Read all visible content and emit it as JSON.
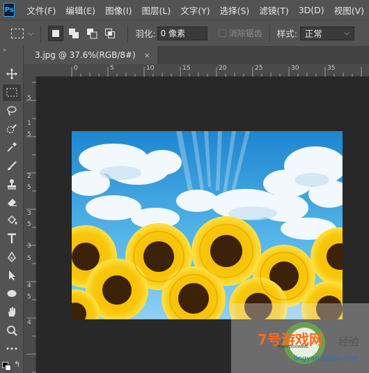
{
  "app": {
    "logo": "Ps"
  },
  "menu": [
    "文件(F)",
    "编辑(E)",
    "图像(I)",
    "图层(L)",
    "文字(Y)",
    "选择(S)",
    "滤镜(T)",
    "3D(D)",
    "视图(V)"
  ],
  "options": {
    "feather_label": "羽化:",
    "feather_value": "0 像素",
    "antialias_label": "消除锯齿",
    "style_label": "样式:",
    "style_value": "正常"
  },
  "document": {
    "tab_title": "3.jpg @ 37.6%(RGB/8#)",
    "close_glyph": "×"
  },
  "rulers": {
    "horizontal": [
      "0",
      "5",
      "10",
      "15",
      "20",
      "25",
      "30",
      "35"
    ],
    "vertical": [
      "5",
      "1",
      "5",
      "2",
      "5",
      "3",
      "5",
      "3",
      "5",
      "4",
      "5",
      "4"
    ]
  },
  "watermark": {
    "site_title": "7号游戏网",
    "site_sub": "7HAOYOUXIWANG",
    "brand": "经验",
    "url": "jingyan.baidu.com"
  },
  "icons": {
    "tools": [
      "move-icon",
      "marquee-icon",
      "lasso-icon",
      "quick-select-icon",
      "eyedropper-icon",
      "brush-icon",
      "stamp-icon",
      "eraser-icon",
      "bucket-icon",
      "type-icon",
      "pen-icon",
      "path-select-icon",
      "ellipse-icon",
      "hand-icon",
      "zoom-icon",
      "more-icon"
    ]
  },
  "colors": {
    "ui_bg": "#535353",
    "canvas_bg": "#282828",
    "ps_blue": "#31a8ff"
  }
}
